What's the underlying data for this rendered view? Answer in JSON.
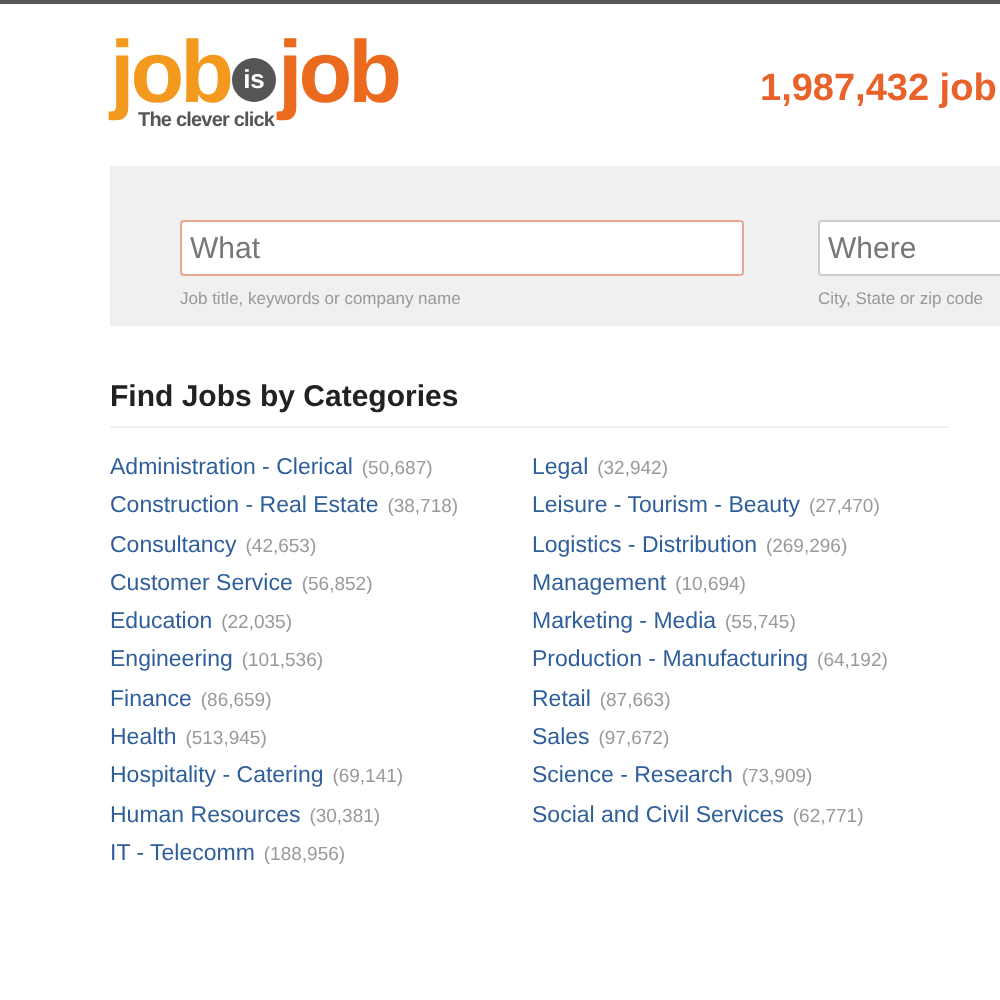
{
  "logo": {
    "left_word": "job",
    "middle_badge": "is",
    "right_word": "job",
    "tagline": "The clever click"
  },
  "job_count": "1,987,432 job",
  "search": {
    "what": {
      "placeholder": "What",
      "hint": "Job title, keywords or company name",
      "focused": true
    },
    "where": {
      "placeholder": "Where",
      "hint": "City, State or zip code",
      "focused": false
    }
  },
  "categories": {
    "title": "Find Jobs by Categories",
    "columns": [
      [
        {
          "name": "Administration - Clerical",
          "count": "(50,687)"
        },
        {
          "name": "Construction - Real Estate",
          "count": "(38,718)"
        },
        {
          "name": "Consultancy",
          "count": "(42,653)"
        },
        {
          "name": "Customer Service",
          "count": "(56,852)"
        },
        {
          "name": "Education",
          "count": "(22,035)"
        },
        {
          "name": "Engineering",
          "count": "(101,536)"
        },
        {
          "name": "Finance",
          "count": "(86,659)"
        },
        {
          "name": "Health",
          "count": "(513,945)"
        },
        {
          "name": "Hospitality - Catering",
          "count": "(69,141)"
        },
        {
          "name": "Human Resources",
          "count": "(30,381)"
        },
        {
          "name": "IT - Telecomm",
          "count": "(188,956)"
        }
      ],
      [
        {
          "name": "Legal",
          "count": "(32,942)"
        },
        {
          "name": "Leisure - Tourism - Beauty",
          "count": "(27,470)"
        },
        {
          "name": "Logistics - Distribution",
          "count": "(269,296)"
        },
        {
          "name": "Management",
          "count": "(10,694)"
        },
        {
          "name": "Marketing - Media",
          "count": "(55,745)"
        },
        {
          "name": "Production - Manufacturing",
          "count": "(64,192)"
        },
        {
          "name": "Retail",
          "count": "(87,663)"
        },
        {
          "name": "Sales",
          "count": "(97,672)"
        },
        {
          "name": "Science - Research",
          "count": "(73,909)"
        },
        {
          "name": "Social and Civil Services",
          "count": "(62,771)"
        }
      ]
    ]
  }
}
